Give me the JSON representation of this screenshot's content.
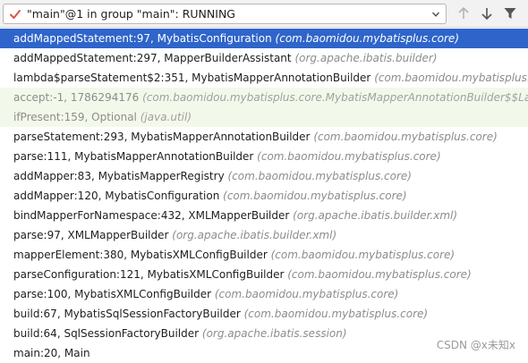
{
  "thread": {
    "label": "\"main\"@1 in group \"main\": RUNNING",
    "status_icon": "check-icon",
    "status_color": "#d9534f"
  },
  "toolbar": {
    "buttons": [
      "arrow-up-icon",
      "arrow-down-icon",
      "filter-icon"
    ]
  },
  "colors": {
    "selected_row": "#2f65ca",
    "library_row": "#f3f9ea",
    "package_text": "#8c8c8c"
  },
  "frames": [
    {
      "method": "addMappedStatement:97, MybatisConfiguration",
      "pkg": "(com.baomidou.mybatisplus.core)"
    },
    {
      "method": "addMappedStatement:297, MapperBuilderAssistant",
      "pkg": "(org.apache.ibatis.builder)"
    },
    {
      "method": "lambda$parseStatement$2:351, MybatisMapperAnnotationBuilder",
      "pkg": "(com.baomidou.mybatisplus.co"
    },
    {
      "method": "accept:-1, 1786294176",
      "pkg": "(com.baomidou.mybatisplus.core.MybatisMapperAnnotationBuilder$$Lamb"
    },
    {
      "method": "ifPresent:159, Optional",
      "pkg": "(java.util)"
    },
    {
      "method": "parseStatement:293, MybatisMapperAnnotationBuilder",
      "pkg": "(com.baomidou.mybatisplus.core)"
    },
    {
      "method": "parse:111, MybatisMapperAnnotationBuilder",
      "pkg": "(com.baomidou.mybatisplus.core)"
    },
    {
      "method": "addMapper:83, MybatisMapperRegistry",
      "pkg": "(com.baomidou.mybatisplus.core)"
    },
    {
      "method": "addMapper:120, MybatisConfiguration",
      "pkg": "(com.baomidou.mybatisplus.core)"
    },
    {
      "method": "bindMapperForNamespace:432, XMLMapperBuilder",
      "pkg": "(org.apache.ibatis.builder.xml)"
    },
    {
      "method": "parse:97, XMLMapperBuilder",
      "pkg": "(org.apache.ibatis.builder.xml)"
    },
    {
      "method": "mapperElement:380, MybatisXMLConfigBuilder",
      "pkg": "(com.baomidou.mybatisplus.core)"
    },
    {
      "method": "parseConfiguration:121, MybatisXMLConfigBuilder",
      "pkg": "(com.baomidou.mybatisplus.core)"
    },
    {
      "method": "parse:100, MybatisXMLConfigBuilder",
      "pkg": "(com.baomidou.mybatisplus.core)"
    },
    {
      "method": "build:67, MybatisSqlSessionFactoryBuilder",
      "pkg": "(com.baomidou.mybatisplus.core)"
    },
    {
      "method": "build:64, SqlSessionFactoryBuilder",
      "pkg": "(org.apache.ibatis.session)"
    },
    {
      "method": "main:20, Main",
      "pkg": ""
    }
  ],
  "watermark": "CSDN @x未知x"
}
